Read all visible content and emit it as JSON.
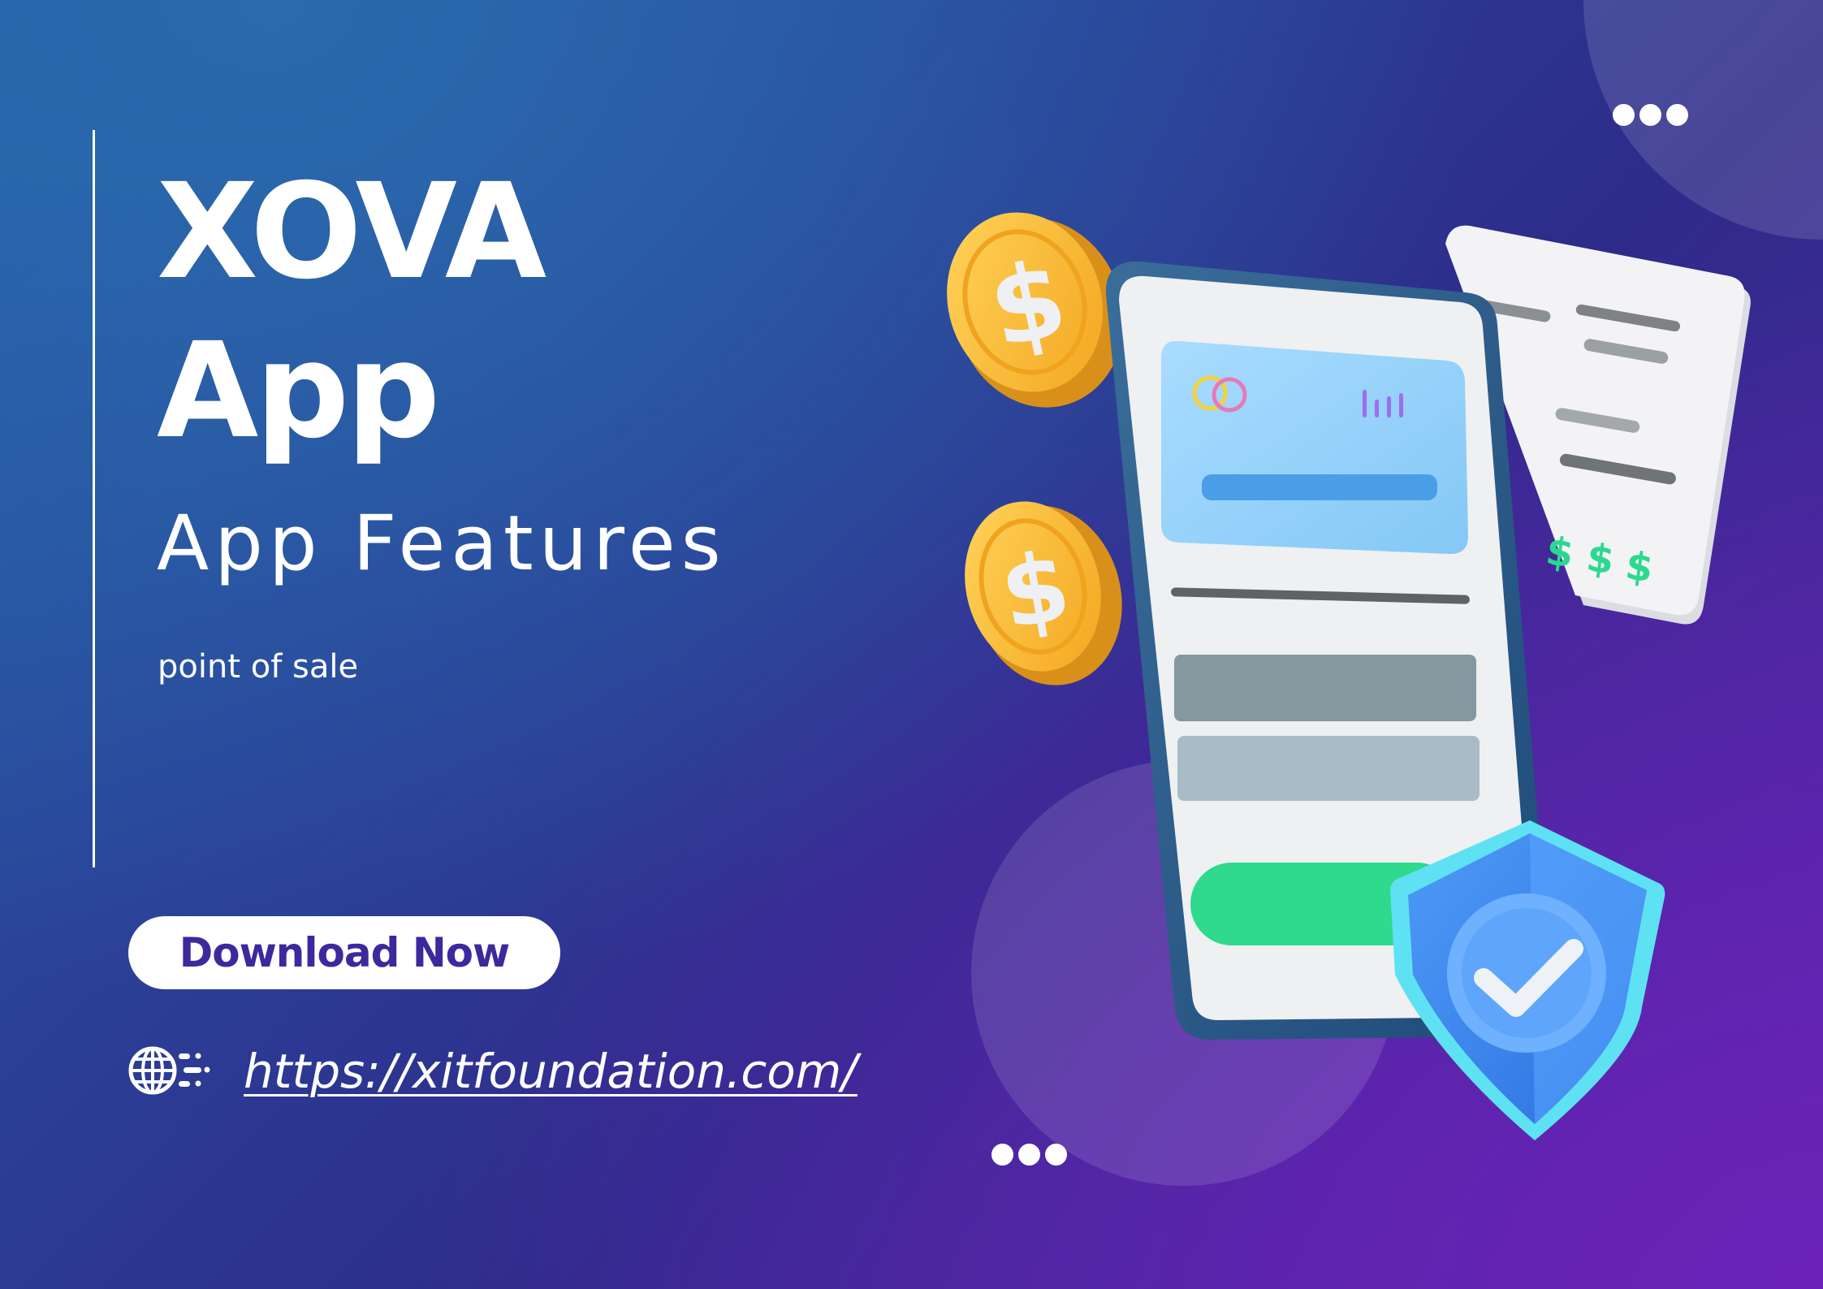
{
  "hero": {
    "title_line1": "XOVA",
    "title_line2": "App",
    "subtitle": "App Features",
    "tagline": "point of sale"
  },
  "cta": {
    "download_label": "Download Now"
  },
  "website": {
    "url_text": "https://xitfoundation.com/",
    "icon": "globe-speed-icon"
  },
  "illustration": {
    "icons": [
      "dollar-coin-icon",
      "smartphone-icon",
      "credit-card-icon",
      "receipt-icon",
      "shield-check-icon",
      "more-dots-icon"
    ],
    "receipt_currency": "$$$"
  },
  "colors": {
    "accent_text": "#3b2a9e",
    "coin": "#f7b52b",
    "money_green": "#2bd98e",
    "shield": "#3f8ef0"
  }
}
